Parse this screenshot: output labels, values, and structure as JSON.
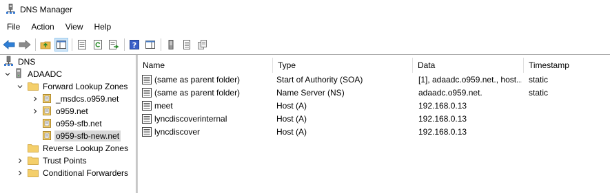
{
  "window": {
    "title": "DNS Manager",
    "icon": "dns-manager-icon"
  },
  "menu": [
    "File",
    "Action",
    "View",
    "Help"
  ],
  "toolbar": {
    "buttons": [
      "back-icon",
      "forward-icon",
      "up-folder-icon",
      "show-hide-tree-icon",
      "properties-icon",
      "refresh-icon",
      "export-list-icon",
      "help-icon",
      "show-hide-action-pane-icon",
      "server-icon",
      "text-file-icon",
      "copy-icon"
    ]
  },
  "tree": {
    "root": "DNS",
    "server": "ADAADC",
    "forward_lookup_zones": "Forward Lookup Zones",
    "zones": [
      "_msdcs.o959.net",
      "o959.net",
      "o959-sfb.net",
      "o959-sfb-new.net"
    ],
    "reverse_lookup_zones": "Reverse Lookup Zones",
    "trust_points": "Trust Points",
    "conditional_forwarders": "Conditional Forwarders"
  },
  "columns": {
    "name": "Name",
    "type": "Type",
    "data": "Data",
    "timestamp": "Timestamp"
  },
  "records": [
    {
      "name": "(same as parent folder)",
      "type": "Start of Authority (SOA)",
      "data": "[1], adaadc.o959.net., host...",
      "timestamp": "static"
    },
    {
      "name": "(same as parent folder)",
      "type": "Name Server (NS)",
      "data": "adaadc.o959.net.",
      "timestamp": "static"
    },
    {
      "name": "meet",
      "type": "Host (A)",
      "data": "192.168.0.13",
      "timestamp": ""
    },
    {
      "name": "lyncdiscoverinternal",
      "type": "Host (A)",
      "data": "192.168.0.13",
      "timestamp": ""
    },
    {
      "name": "lyncdiscover",
      "type": "Host (A)",
      "data": "192.168.0.13",
      "timestamp": ""
    }
  ]
}
